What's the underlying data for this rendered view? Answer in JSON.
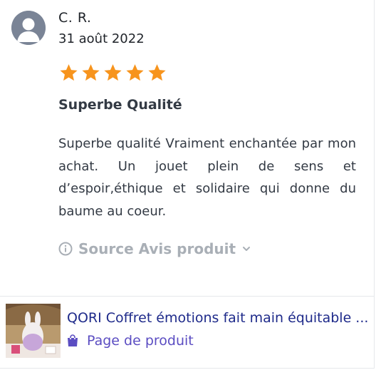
{
  "review": {
    "author": "C. R.",
    "date": "31 août 2022",
    "rating": 5,
    "rating_max": 5,
    "title": "Superbe Qualité",
    "body": "Superbe qualité Vraiment enchantée par mon achat. Un jouet plein de sens et d’espoir,éthique et solidaire qui donne du baume au coeur.",
    "source_label": "Source Avis produit"
  },
  "product": {
    "name": "QORI Coffret émotions fait main équitable ...",
    "link_label": "Page de produit"
  },
  "colors": {
    "star": "#f7941d",
    "product_name": "#1e2a8a",
    "product_link": "#5b4dc2",
    "muted": "#a9afb6"
  },
  "icons": {
    "avatar": "user-avatar-icon",
    "star": "star-icon",
    "info": "info-icon",
    "chevron": "chevron-down-icon",
    "bag": "shopping-bag-icon"
  }
}
